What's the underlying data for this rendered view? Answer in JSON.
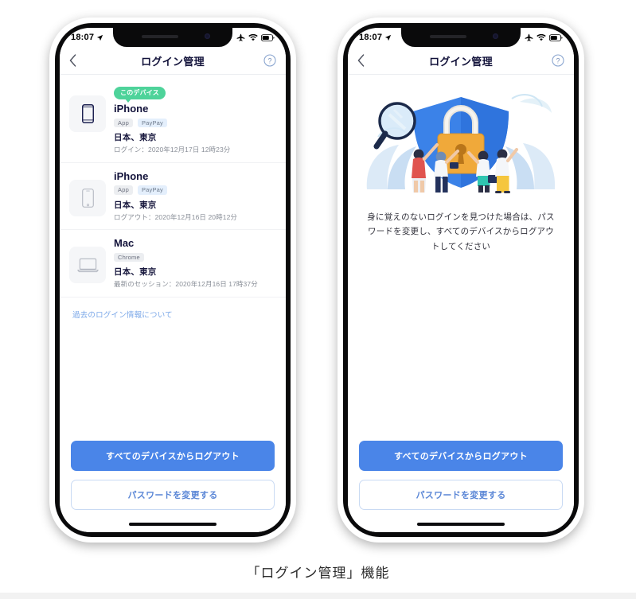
{
  "caption": "「ログイン管理」機能",
  "colors": {
    "accent_blue": "#4a85e8",
    "badge_green": "#4ed39a",
    "title_navy": "#12123a",
    "link_blue": "#7aa7e8",
    "shield_blue": "#3b82e8",
    "lock_orange": "#f0a93a"
  },
  "status_bar": {
    "time": "18:07",
    "location_icon": "location-arrow-icon",
    "airplane_icon": "airplane-mode-icon",
    "wifi_icon": "wifi-icon",
    "battery_icon": "battery-icon"
  },
  "nav": {
    "back_icon": "chevron-left-icon",
    "title": "ログイン管理",
    "help_icon": "help-circle-icon"
  },
  "left_phone": {
    "devices": [
      {
        "badge": "このデバイス",
        "name": "iPhone",
        "tags": [
          "App",
          "PayPay"
        ],
        "location": "日本、東京",
        "meta": "ログイン：2020年12月17日 12時23分",
        "icon": "phone-icon",
        "icon_active": true
      },
      {
        "badge": "",
        "name": "iPhone",
        "tags": [
          "App",
          "PayPay"
        ],
        "location": "日本、東京",
        "meta": "ログアウト：2020年12月16日 20時12分",
        "icon": "phone-icon",
        "icon_active": false
      },
      {
        "badge": "",
        "name": "Mac",
        "tags": [
          "Chrome"
        ],
        "location": "日本、東京",
        "meta": "最新のセッション：2020年12月16日 17時37分",
        "icon": "laptop-icon",
        "icon_active": false
      }
    ],
    "history_link": "過去のログイン情報について",
    "logout_all_button": "すべてのデバイスからログアウト",
    "change_password_button": "パスワードを変更する"
  },
  "right_phone": {
    "illustration": "security-shield-lock-illustration",
    "message": "身に覚えのないログインを見つけた場合は、パスワードを変更し、すべてのデバイスからログアウトしてください",
    "logout_all_button": "すべてのデバイスからログアウト",
    "change_password_button": "パスワードを変更する"
  }
}
